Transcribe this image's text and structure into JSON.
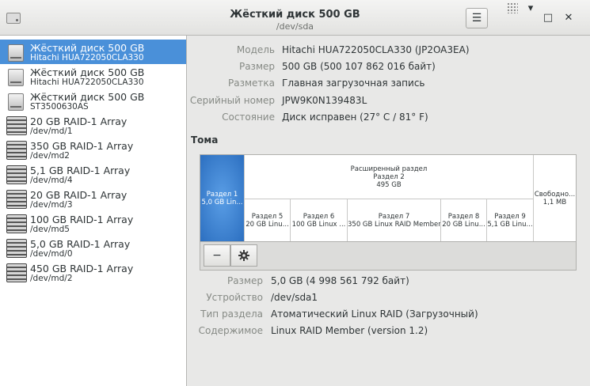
{
  "window": {
    "title": "Жёсткий диск 500 GB",
    "subtitle": "/dev/sda",
    "menu_icon": "hamburger-menu-icon",
    "controls": [
      "minimize",
      "maximize",
      "close"
    ]
  },
  "sidebar": {
    "items": [
      {
        "title": "Жёсткий диск 500 GB",
        "subtitle": "Hitachi HUA722050CLA330",
        "icon": "hard-disk",
        "selected": true
      },
      {
        "title": "Жёсткий диск 500 GB",
        "subtitle": "Hitachi HUA722050CLA330",
        "icon": "hard-disk"
      },
      {
        "title": "Жёсткий диск 500 GB",
        "subtitle": "ST3500630AS",
        "icon": "hard-disk"
      },
      {
        "title": "20 GB RAID-1 Array",
        "subtitle": "/dev/md/1",
        "icon": "raid-array"
      },
      {
        "title": "350 GB RAID-1 Array",
        "subtitle": "/dev/md2",
        "icon": "raid-array"
      },
      {
        "title": "5,1 GB RAID-1 Array",
        "subtitle": "/dev/md/4",
        "icon": "raid-array"
      },
      {
        "title": "20 GB RAID-1 Array",
        "subtitle": "/dev/md/3",
        "icon": "raid-array"
      },
      {
        "title": "100 GB RAID-1 Array",
        "subtitle": "/dev/md5",
        "icon": "raid-array"
      },
      {
        "title": "5,0 GB RAID-1 Array",
        "subtitle": "/dev/md/0",
        "icon": "raid-array"
      },
      {
        "title": "450 GB RAID-1 Array",
        "subtitle": "/dev/md/2",
        "icon": "raid-array"
      }
    ]
  },
  "disk_info": [
    {
      "label": "Модель",
      "value": "Hitachi HUA722050CLA330 (JP2OA3EA)"
    },
    {
      "label": "Размер",
      "value": "500 GB (500 107 862 016 байт)"
    },
    {
      "label": "Разметка",
      "value": "Главная загрузочная запись"
    },
    {
      "label": "Серийный номер",
      "value": "JPW9K0N139483L"
    },
    {
      "label": "Состояние",
      "value": "Диск исправен (27° C / 81° F)"
    }
  ],
  "volumes": {
    "heading": "Тома",
    "partition1": {
      "name": "Раздел 1",
      "desc": "5,0 GB Lin..."
    },
    "extended": {
      "name": "Расширенный раздел",
      "sub": "Раздел 2",
      "size": "495 GB"
    },
    "free": {
      "name": "Свободно...",
      "size": "1,1 MB"
    },
    "logical": [
      {
        "name": "Раздел 5",
        "desc": "20 GB Linu..."
      },
      {
        "name": "Раздел 6",
        "desc": "100 GB Linux ..."
      },
      {
        "name": "Раздел 7",
        "desc": "350 GB Linux RAID Member"
      },
      {
        "name": "Раздел 8",
        "desc": "20 GB Linu..."
      },
      {
        "name": "Раздел 9",
        "desc": "5,1 GB Linu..."
      }
    ],
    "buttons": {
      "remove": "−",
      "settings_icon": "gear-icon"
    }
  },
  "partition_info": [
    {
      "label": "Размер",
      "value": "5,0 GB (4 998 561 792 байт)"
    },
    {
      "label": "Устройство",
      "value": "/dev/sda1"
    },
    {
      "label": "Тип раздела",
      "value": "Атоматический Linux RAID (Загрузочный)"
    },
    {
      "label": "Содержимое",
      "value": "Linux RAID Member (version 1.2)"
    }
  ],
  "colors": {
    "selection": "#4a90d9",
    "partition_selected": "#2c6fc0"
  }
}
